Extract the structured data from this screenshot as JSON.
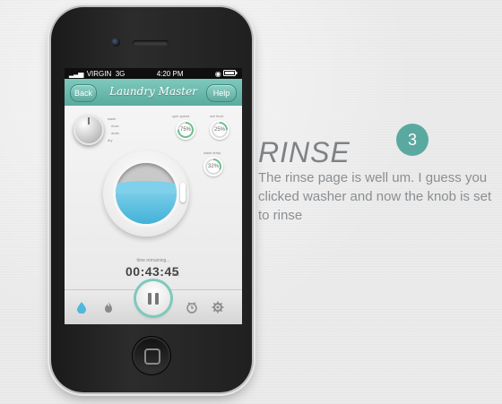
{
  "status_bar": {
    "carrier": "VIRGIN",
    "network": "3G",
    "time": "4:20 PM"
  },
  "nav": {
    "back_label": "Back",
    "title": "Laundry Master",
    "help_label": "Help"
  },
  "knob": {
    "labels": [
      "wash",
      "rinse",
      "drain",
      "dry"
    ]
  },
  "dials": [
    {
      "label": "spin speed",
      "value": "75%",
      "fraction": 0.75
    },
    {
      "label": "soil level",
      "value": "25%",
      "fraction": 0.25
    },
    {
      "label": "wash temp",
      "value": "32%",
      "fraction": 0.32
    }
  ],
  "timer": {
    "label": "time remaining...",
    "value": "00:43:45",
    "unit": "sec"
  },
  "tabbar": {
    "items": [
      "water-drop-icon",
      "flame-icon",
      "pause-icon",
      "clock-icon",
      "gear-icon"
    ]
  },
  "step": {
    "number": "3",
    "heading": "RINSE",
    "description": "The rinse page is well um. I guess you clicked washer and now the knob is set to rinse"
  },
  "colors": {
    "accent": "#5aab9f",
    "water": "#43b2d8",
    "badge": "#5aa9a0",
    "text": "#8a8e92"
  }
}
